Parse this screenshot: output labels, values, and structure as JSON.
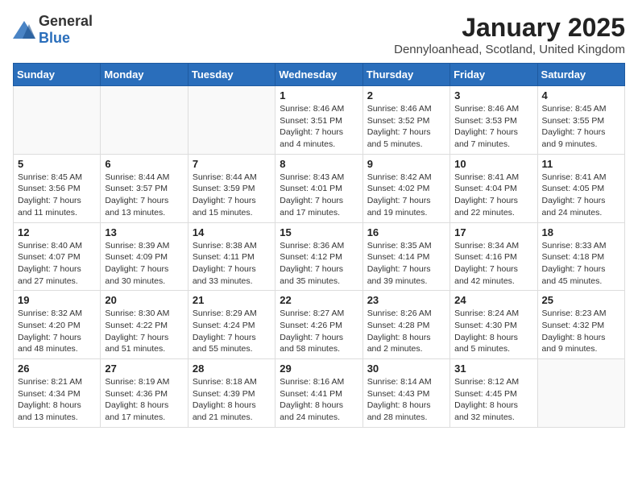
{
  "logo": {
    "general": "General",
    "blue": "Blue"
  },
  "title": "January 2025",
  "location": "Dennyloanhead, Scotland, United Kingdom",
  "weekdays": [
    "Sunday",
    "Monday",
    "Tuesday",
    "Wednesday",
    "Thursday",
    "Friday",
    "Saturday"
  ],
  "weeks": [
    [
      {
        "day": "",
        "info": ""
      },
      {
        "day": "",
        "info": ""
      },
      {
        "day": "",
        "info": ""
      },
      {
        "day": "1",
        "info": "Sunrise: 8:46 AM\nSunset: 3:51 PM\nDaylight: 7 hours and 4 minutes."
      },
      {
        "day": "2",
        "info": "Sunrise: 8:46 AM\nSunset: 3:52 PM\nDaylight: 7 hours and 5 minutes."
      },
      {
        "day": "3",
        "info": "Sunrise: 8:46 AM\nSunset: 3:53 PM\nDaylight: 7 hours and 7 minutes."
      },
      {
        "day": "4",
        "info": "Sunrise: 8:45 AM\nSunset: 3:55 PM\nDaylight: 7 hours and 9 minutes."
      }
    ],
    [
      {
        "day": "5",
        "info": "Sunrise: 8:45 AM\nSunset: 3:56 PM\nDaylight: 7 hours and 11 minutes."
      },
      {
        "day": "6",
        "info": "Sunrise: 8:44 AM\nSunset: 3:57 PM\nDaylight: 7 hours and 13 minutes."
      },
      {
        "day": "7",
        "info": "Sunrise: 8:44 AM\nSunset: 3:59 PM\nDaylight: 7 hours and 15 minutes."
      },
      {
        "day": "8",
        "info": "Sunrise: 8:43 AM\nSunset: 4:01 PM\nDaylight: 7 hours and 17 minutes."
      },
      {
        "day": "9",
        "info": "Sunrise: 8:42 AM\nSunset: 4:02 PM\nDaylight: 7 hours and 19 minutes."
      },
      {
        "day": "10",
        "info": "Sunrise: 8:41 AM\nSunset: 4:04 PM\nDaylight: 7 hours and 22 minutes."
      },
      {
        "day": "11",
        "info": "Sunrise: 8:41 AM\nSunset: 4:05 PM\nDaylight: 7 hours and 24 minutes."
      }
    ],
    [
      {
        "day": "12",
        "info": "Sunrise: 8:40 AM\nSunset: 4:07 PM\nDaylight: 7 hours and 27 minutes."
      },
      {
        "day": "13",
        "info": "Sunrise: 8:39 AM\nSunset: 4:09 PM\nDaylight: 7 hours and 30 minutes."
      },
      {
        "day": "14",
        "info": "Sunrise: 8:38 AM\nSunset: 4:11 PM\nDaylight: 7 hours and 33 minutes."
      },
      {
        "day": "15",
        "info": "Sunrise: 8:36 AM\nSunset: 4:12 PM\nDaylight: 7 hours and 35 minutes."
      },
      {
        "day": "16",
        "info": "Sunrise: 8:35 AM\nSunset: 4:14 PM\nDaylight: 7 hours and 39 minutes."
      },
      {
        "day": "17",
        "info": "Sunrise: 8:34 AM\nSunset: 4:16 PM\nDaylight: 7 hours and 42 minutes."
      },
      {
        "day": "18",
        "info": "Sunrise: 8:33 AM\nSunset: 4:18 PM\nDaylight: 7 hours and 45 minutes."
      }
    ],
    [
      {
        "day": "19",
        "info": "Sunrise: 8:32 AM\nSunset: 4:20 PM\nDaylight: 7 hours and 48 minutes."
      },
      {
        "day": "20",
        "info": "Sunrise: 8:30 AM\nSunset: 4:22 PM\nDaylight: 7 hours and 51 minutes."
      },
      {
        "day": "21",
        "info": "Sunrise: 8:29 AM\nSunset: 4:24 PM\nDaylight: 7 hours and 55 minutes."
      },
      {
        "day": "22",
        "info": "Sunrise: 8:27 AM\nSunset: 4:26 PM\nDaylight: 7 hours and 58 minutes."
      },
      {
        "day": "23",
        "info": "Sunrise: 8:26 AM\nSunset: 4:28 PM\nDaylight: 8 hours and 2 minutes."
      },
      {
        "day": "24",
        "info": "Sunrise: 8:24 AM\nSunset: 4:30 PM\nDaylight: 8 hours and 5 minutes."
      },
      {
        "day": "25",
        "info": "Sunrise: 8:23 AM\nSunset: 4:32 PM\nDaylight: 8 hours and 9 minutes."
      }
    ],
    [
      {
        "day": "26",
        "info": "Sunrise: 8:21 AM\nSunset: 4:34 PM\nDaylight: 8 hours and 13 minutes."
      },
      {
        "day": "27",
        "info": "Sunrise: 8:19 AM\nSunset: 4:36 PM\nDaylight: 8 hours and 17 minutes."
      },
      {
        "day": "28",
        "info": "Sunrise: 8:18 AM\nSunset: 4:39 PM\nDaylight: 8 hours and 21 minutes."
      },
      {
        "day": "29",
        "info": "Sunrise: 8:16 AM\nSunset: 4:41 PM\nDaylight: 8 hours and 24 minutes."
      },
      {
        "day": "30",
        "info": "Sunrise: 8:14 AM\nSunset: 4:43 PM\nDaylight: 8 hours and 28 minutes."
      },
      {
        "day": "31",
        "info": "Sunrise: 8:12 AM\nSunset: 4:45 PM\nDaylight: 8 hours and 32 minutes."
      },
      {
        "day": "",
        "info": ""
      }
    ]
  ]
}
